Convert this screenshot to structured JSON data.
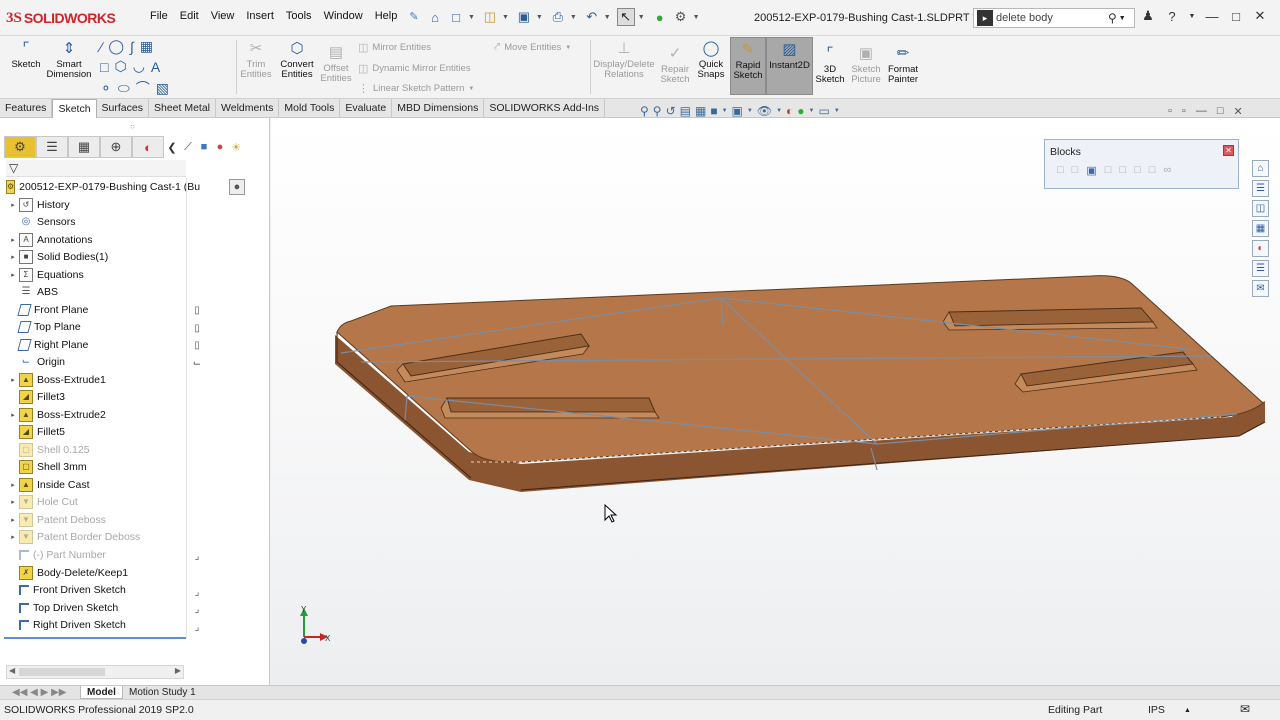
{
  "app": {
    "brand_prefix": "3S",
    "brand": "SOLIDWORKS"
  },
  "menu": [
    "File",
    "Edit",
    "View",
    "Insert",
    "Tools",
    "Window",
    "Help"
  ],
  "document_title": "200512-EXP-0179-Bushing Cast-1.SLDPRT *",
  "search": {
    "value": "delete body"
  },
  "command_manager": {
    "sketch": "Sketch",
    "smart_dimension": [
      "Smart",
      "Dimension"
    ],
    "trim_entities": [
      "Trim",
      "Entities"
    ],
    "convert_entities": [
      "Convert",
      "Entities"
    ],
    "offset_entities": [
      "Offset",
      "Entities"
    ],
    "mirror_entities": "Mirror Entities",
    "dynamic_mirror": "Dynamic Mirror Entities",
    "linear_pattern": "Linear Sketch Pattern",
    "move_entities": "Move Entities",
    "display_delete_relations": [
      "Display/Delete",
      "Relations"
    ],
    "repair_sketch": [
      "Repair",
      "Sketch"
    ],
    "quick_snaps": [
      "Quick",
      "Snaps"
    ],
    "rapid_sketch": [
      "Rapid",
      "Sketch"
    ],
    "instant2d": "Instant2D",
    "sketch3d": [
      "3D",
      "Sketch"
    ],
    "sketch_picture": [
      "Sketch",
      "Picture"
    ],
    "format_painter": [
      "Format",
      "Painter"
    ]
  },
  "tabs": [
    "Features",
    "Sketch",
    "Surfaces",
    "Sheet Metal",
    "Weldments",
    "Mold Tools",
    "Evaluate",
    "MBD Dimensions",
    "SOLIDWORKS Add-Ins"
  ],
  "tree": {
    "root": "200512-EXP-0179-Bushing Cast-1  (Bu",
    "nodes": [
      {
        "label": "History"
      },
      {
        "label": "Sensors"
      },
      {
        "label": "Annotations"
      },
      {
        "label": "Solid Bodies(1)"
      },
      {
        "label": "Equations"
      },
      {
        "label": "ABS"
      },
      {
        "label": "Front Plane"
      },
      {
        "label": "Top Plane"
      },
      {
        "label": "Right Plane"
      },
      {
        "label": "Origin"
      },
      {
        "label": "Boss-Extrude1"
      },
      {
        "label": "Fillet3"
      },
      {
        "label": "Boss-Extrude2"
      },
      {
        "label": "Fillet5"
      },
      {
        "label": "Shell 0.125"
      },
      {
        "label": "Shell 3mm"
      },
      {
        "label": "Inside Cast"
      },
      {
        "label": "Hole Cut"
      },
      {
        "label": "Patent Deboss"
      },
      {
        "label": "Patent Border Deboss"
      },
      {
        "label": "(-) Part Number"
      },
      {
        "label": "Body-Delete/Keep1"
      },
      {
        "label": "Front Driven Sketch"
      },
      {
        "label": "Top Driven Sketch"
      },
      {
        "label": "Right Driven Sketch"
      }
    ]
  },
  "blocks_toolbar": {
    "title": "Blocks"
  },
  "triad": {
    "y": "Y",
    "x": "X"
  },
  "bottom_tabs": [
    "Model",
    "Motion Study 1"
  ],
  "status": {
    "left": "SOLIDWORKS Professional 2019 SP2.0",
    "mode": "Editing Part",
    "units": "IPS"
  },
  "colors": {
    "part": "#b5774a",
    "part_dark": "#8a5530",
    "brand_red": "#d2232a",
    "accent_blue": "#2a5d9a"
  }
}
